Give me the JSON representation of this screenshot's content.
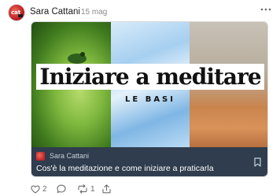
{
  "post": {
    "author": "Sara Cattani",
    "date": "15 mag",
    "avatar_text": "cat",
    "more_icon": "more-horizontal-icon"
  },
  "card": {
    "hero_title": "Iniziare a meditare",
    "hero_subtitle": "LE BASI",
    "publication": "Sara Cattani",
    "link_title": "Cos'è la meditazione e come iniziare a praticarla",
    "bookmark_icon": "bookmark-icon"
  },
  "actions": {
    "likes": "2",
    "comments": "",
    "restacks": "1",
    "icons": [
      "heart-icon",
      "comment-icon",
      "restack-icon",
      "share-icon"
    ]
  },
  "colors": {
    "footer_bg": "#2f3d4e",
    "accent": "#c0262a"
  }
}
